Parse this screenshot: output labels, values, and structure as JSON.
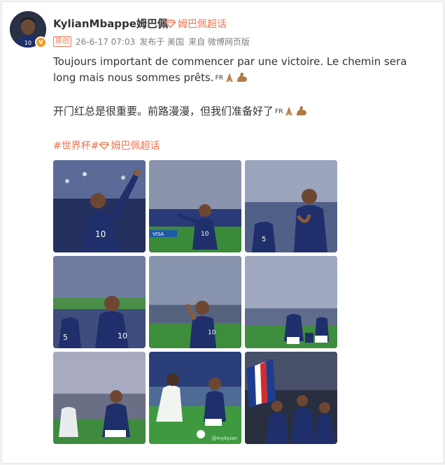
{
  "post": {
    "username": "KylianMbappe姆巴佩",
    "supertopic_label": "姆巴佩超话",
    "badge": "原创",
    "timestamp": "26-6-17 07:03",
    "published_from": "发布于 美国",
    "source": "来自 微博网页版",
    "text_fr": "Toujours important de commencer par une victoire. Le chemin sera long mais nous sommes prêts.",
    "flag_fr_1": "FR",
    "text_zh": "开门红总是很重要。前路漫漫，但我们准备好了",
    "flag_fr_2": "FR",
    "hashtag": "#世界杯#",
    "topic_tag": "姆巴佩超话"
  },
  "photos": [
    {
      "name": "photo-1"
    },
    {
      "name": "photo-2"
    },
    {
      "name": "photo-3"
    },
    {
      "name": "photo-4"
    },
    {
      "name": "photo-5"
    },
    {
      "name": "photo-6"
    },
    {
      "name": "photo-7"
    },
    {
      "name": "photo-8",
      "watermark": "@mykyian"
    },
    {
      "name": "photo-9"
    }
  ],
  "icons": {
    "supertopic": "diamond-icon",
    "pray": "folded-hands-icon",
    "muscle": "flexed-biceps-icon",
    "verified": "verified-badge-icon"
  },
  "colors": {
    "accent": "#eb7350",
    "verified": "#f29a1f",
    "france_blue": "#1f2f6b"
  }
}
